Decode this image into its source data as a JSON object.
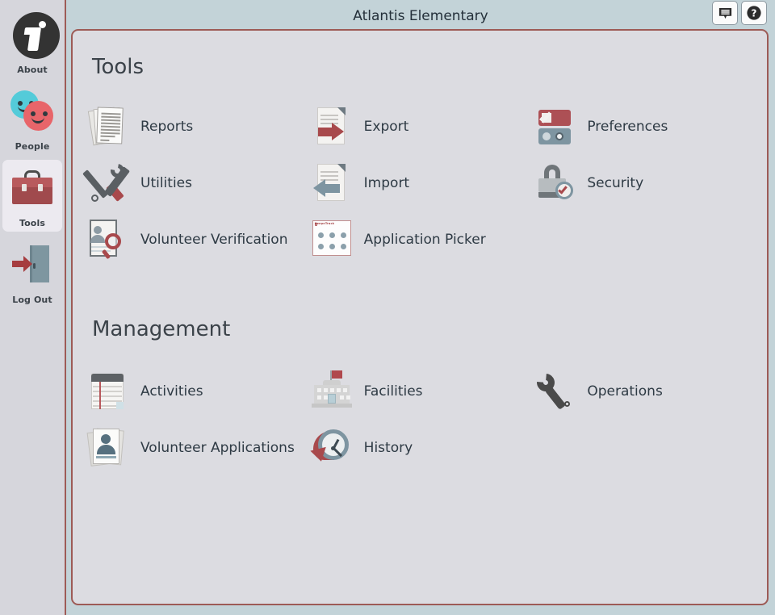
{
  "header": {
    "title": "Atlantis Elementary",
    "buttons": [
      {
        "name": "notes-button",
        "icon": "notes-icon"
      },
      {
        "name": "help-button",
        "icon": "help-icon"
      }
    ]
  },
  "sidebar": {
    "items": [
      {
        "label": "About",
        "icon": "info-icon",
        "selected": false
      },
      {
        "label": "People",
        "icon": "people-icon",
        "selected": false
      },
      {
        "label": "Tools",
        "icon": "toolbox-icon",
        "selected": true
      },
      {
        "label": "Log Out",
        "icon": "logout-icon",
        "selected": false
      }
    ]
  },
  "main": {
    "sections": [
      {
        "title": "Tools",
        "items": [
          {
            "label": "Reports",
            "icon": "reports-icon"
          },
          {
            "label": "Export",
            "icon": "export-icon"
          },
          {
            "label": "Preferences",
            "icon": "preferences-icon"
          },
          {
            "label": "Utilities",
            "icon": "utilities-icon"
          },
          {
            "label": "Import",
            "icon": "import-icon"
          },
          {
            "label": "Security",
            "icon": "security-icon"
          },
          {
            "label": "Volunteer Verification",
            "icon": "volunteer-verification-icon"
          },
          {
            "label": "Application Picker",
            "icon": "application-picker-icon"
          }
        ]
      },
      {
        "title": "Management",
        "items": [
          {
            "label": "Activities",
            "icon": "activities-icon"
          },
          {
            "label": "Facilities",
            "icon": "facilities-icon"
          },
          {
            "label": "Operations",
            "icon": "operations-icon"
          },
          {
            "label": "Volunteer Applications",
            "icon": "volunteer-applications-icon"
          },
          {
            "label": "History",
            "icon": "history-icon"
          }
        ]
      }
    ]
  },
  "icons": {
    "application_picker_brand": "KeepnTrack"
  },
  "colors": {
    "accent_red": "#a8494c",
    "panel_border": "#9d5b56",
    "panel_bg": "#dcdce1",
    "sidebar_bg": "#d6d6dc",
    "window_bg": "#c3d3d8",
    "slate_blue": "#7e95a1",
    "text_dark": "#2e3a44"
  }
}
